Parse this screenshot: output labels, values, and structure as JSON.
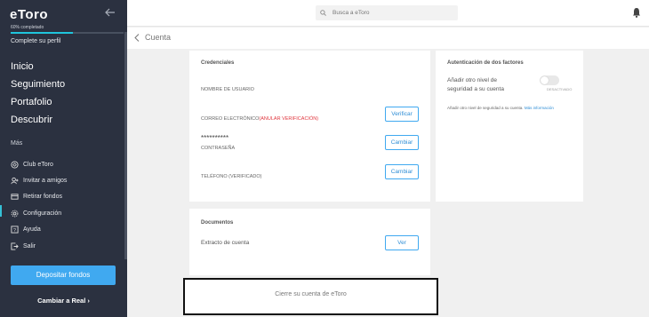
{
  "sidebar": {
    "logo": "eToro",
    "progress_text": "60% completado",
    "progress_fraction": 0.55,
    "profile_link": "Complete su perfil",
    "main_nav": [
      "Inicio",
      "Seguimiento",
      "Portafolio",
      "Descubrir"
    ],
    "more_title": "Más",
    "sub_nav": [
      {
        "label": "Club eToro",
        "icon": "club-icon"
      },
      {
        "label": "Invitar a amigos",
        "icon": "invite-icon"
      },
      {
        "label": "Retirar fondos",
        "icon": "withdraw-icon"
      },
      {
        "label": "Configuración",
        "icon": "gear-icon"
      },
      {
        "label": "Ayuda",
        "icon": "help-icon"
      },
      {
        "label": "Salir",
        "icon": "logout-icon"
      }
    ],
    "deposit_label": "Depositar fondos",
    "switch_real_label": "Cambiar a Real ›"
  },
  "topbar": {
    "search_placeholder": "Busca a eToro"
  },
  "page": {
    "back_label": "Cuenta"
  },
  "credentials": {
    "title": "Credenciales",
    "username_label": "NOMBRE DE USUARIO",
    "email_label": "CORREO ELECTRÓNICO",
    "email_status": "(ANULAR VERIFICACIÓN)",
    "verify_button": "Verificar",
    "password_masked": "**********",
    "password_label": "CONTRASEÑA",
    "change_password_button": "Cambiar",
    "phone_label": "TELÉFONO (VERIFICADO)",
    "change_phone_button": "Cambiar"
  },
  "two_factor": {
    "title": "Autenticación de dos factores",
    "description": "Añadir otro nivel de seguridad a su cuenta",
    "toggle_state": "DESACTIVADO",
    "info_text": "Añadir otro nivel de seguridad a su cuenta.",
    "more_info_link": "Más información"
  },
  "documents": {
    "title": "Documentos",
    "statement_label": "Extracto de cuenta",
    "view_button": "Ver"
  },
  "close_account": {
    "label": "Cierre su cuenta de eToro"
  },
  "colors": {
    "sidebar_bg": "#2b3140",
    "accent": "#40a9f0",
    "progress": "#1fc5dc",
    "warning": "#e0353d"
  }
}
